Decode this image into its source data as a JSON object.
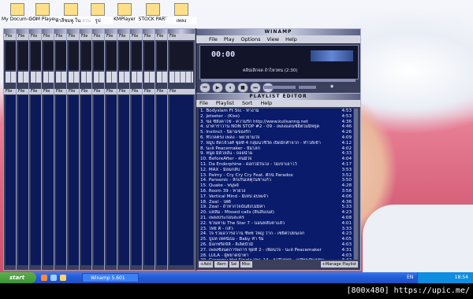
{
  "desktop_icons": [
    {
      "label": "My Documents",
      "icon": "folder-icon"
    },
    {
      "label": "GOM Player",
      "icon": "media-player-icon"
    },
    {
      "label": "ฟ้าสีชมพู ใน สวน",
      "icon": "folder-icon"
    },
    {
      "label": "รูป",
      "icon": "folder-icon"
    },
    {
      "label": "KMPlayer",
      "icon": "media-player-icon"
    },
    {
      "label": "STOCK PART",
      "icon": "folder-icon"
    },
    {
      "label": "เพลง",
      "icon": "folder-icon"
    }
  ],
  "stack_menu": "File",
  "winamp": {
    "title": "WINAMP",
    "menu": [
      "File",
      "Play",
      "Options",
      "View",
      "Help"
    ],
    "time": "00:00",
    "song_text": "คลิปเลิกจด ถ้าไหวทน (2:30)",
    "controls": [
      "prev",
      "play",
      "pause",
      "stop",
      "next",
      "eject"
    ]
  },
  "playlist": {
    "title": "PLAYLIST EDITOR",
    "menu": [
      "File",
      "Playlist",
      "Sort",
      "Help"
    ],
    "rows": [
      {
        "n": "1.",
        "t": "Bodyslam Ft Stc - ทางาม",
        "d": "4:53"
      },
      {
        "n": "2.",
        "t": "Jetseter - (Kiss)",
        "d": "4:53"
      },
      {
        "n": "3.",
        "t": "ขอ ซียังคาไซ - ความรัก http://www.kulisanng.net",
        "d": "4:36"
      },
      {
        "n": "4.",
        "t": "ม่าคาราวาน NON STOP #2 - 09 - เพลงแดนซ์ฮิตไม่มีหยุด",
        "d": "4:46"
      },
      {
        "n": "5.",
        "t": "Instinct - นิยามของรัก",
        "d": "4:26"
      },
      {
        "n": "6.",
        "t": "ที่ไกลตรง เพลง - พยายามใจ",
        "d": "4:09"
      },
      {
        "n": "7.",
        "t": "หมู่บ สิดโจ้วงศ์ ชุดที่ 4 กลุ่มนวชีวัด เปิดอีกคำจาก - ทำได้เข้า",
        "d": "4:12"
      },
      {
        "n": "8.",
        "t": "นะล Peacemaker - ยิ้มโลก",
        "d": "4:02"
      },
      {
        "n": "9.",
        "t": "หนู่ย มีด้วยงั้น - ถอยน้ำม",
        "d": "4:33"
      },
      {
        "n": "10.",
        "t": "BeforeAfter - คนมีใจ",
        "d": "4:04"
      },
      {
        "n": "11.",
        "t": "Da Endorphine - ดอกไม้ในวง - ไม่เขาเอาไว้",
        "d": "4:17"
      },
      {
        "n": "12.",
        "t": "MAX - มีลมกลับ",
        "d": "3:53"
      },
      {
        "n": "13.",
        "t": "Palmy - Cry Cry Cry Feat. ตั๊กน์ Paradox",
        "d": "3:52"
      },
      {
        "n": "14.",
        "t": "Pansonic - ลึกเกินเหตุในชาแก้ว",
        "d": "3:50"
      },
      {
        "n": "15.",
        "t": "Quake - พนุษย์",
        "d": "4:28"
      },
      {
        "n": "16.",
        "t": "Room 39 - หายวง",
        "d": "3:56"
      },
      {
        "n": "17.",
        "t": "Vertical Mind - มีเทป อบพเจ้า",
        "d": "4:06"
      },
      {
        "n": "18.",
        "t": "Zeal - ไต่ติ",
        "d": "4:36"
      },
      {
        "n": "19.",
        "t": "Zeal - ถ้าหากใจฉันยังไม่มีค่า",
        "d": "5:33"
      },
      {
        "n": "20.",
        "t": "แหลีม - Missed calls (สิ้นฮิบเนส)",
        "d": "4:23"
      },
      {
        "n": "21.",
        "t": "เพลงประกอบละคร",
        "d": "4:08"
      },
      {
        "n": "22.",
        "t": "ชวนหาม The Star 7 - นอนหลับตาแล้ว",
        "d": "4:01"
      },
      {
        "n": "23.",
        "t": "ไทย์ คิ - กลัว",
        "d": "3:33"
      },
      {
        "n": "24.",
        "t": "ใจ รวมอวารอวาน ชีพช ใหญ่ ว่าก - เซยิตไปยนเจก",
        "d": "4:23"
      },
      {
        "n": "25.",
        "t": "ปู่แท เทคนิธม - Baby ทำ ร้ม",
        "d": "4:05"
      },
      {
        "n": "26.",
        "t": "ม็อกฟรีดจิลี - ลีเล็ตป๋วมี",
        "d": "4:03"
      },
      {
        "n": "27.",
        "t": "เพลงซึ้งนดการพการ ชุดที่ 2 - เพื่อนใจ - นะล Peacemaker",
        "d": "4:31"
      },
      {
        "n": "28.",
        "t": "LULA - ผู้หยาดน้ำตา",
        "d": "4:03"
      },
      {
        "n": "29.",
        "t": "Grammy Hot Single Vol. 14 - ลาสิโรฟค - เปลี่ยนกันเปยม",
        "d": "3:42"
      }
    ],
    "buttons": [
      "+Add",
      "-Rem",
      "Sel",
      "Misc",
      "+Manage Playlist"
    ],
    "scroll": 0.0
  },
  "taskbar": {
    "start": "start",
    "tasks": [
      {
        "label": "Winamp 5.601",
        "icon": "winamp-icon"
      }
    ],
    "lang": "EN",
    "clock": "18:54"
  },
  "watermark": "[800x480] https://upic.me/"
}
